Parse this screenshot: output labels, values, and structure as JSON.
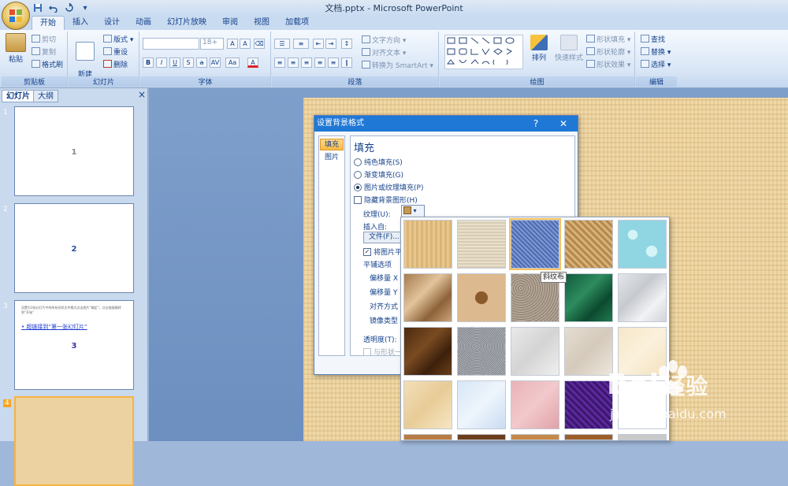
{
  "window": {
    "title": "文档.pptx - Microsoft PowerPoint"
  },
  "qat": {
    "save": "save-icon",
    "undo": "undo-icon",
    "redo": "redo-icon",
    "customize": "▾"
  },
  "tabs": [
    "开始",
    "插入",
    "设计",
    "动画",
    "幻灯片放映",
    "审阅",
    "视图",
    "加载项"
  ],
  "ribbon": {
    "clipboard": {
      "name": "剪贴板",
      "paste": "粘贴",
      "cut": "剪切",
      "copy": "复制",
      "painter": "格式刷"
    },
    "slides": {
      "name": "幻灯片",
      "new_slide": "新建\n幻灯片",
      "layout": "版式",
      "reset": "重设",
      "delete": "删除"
    },
    "font": {
      "name": "字体",
      "size": "18+",
      "grow": "A",
      "shrink": "A",
      "bold": "B",
      "italic": "I",
      "underline": "U",
      "strike": "S",
      "case": "Aa",
      "color": "A"
    },
    "paragraph": {
      "name": "段落",
      "text_dir": "文字方向",
      "align_text": "对齐文本",
      "smartart": "转换为 SmartArt"
    },
    "drawing": {
      "name": "绘图",
      "arrange": "排列",
      "quick_styles": "快速样式",
      "fill": "形状填充",
      "outline": "形状轮廓",
      "effects": "形状效果"
    },
    "editing": {
      "name": "编辑",
      "find": "查找",
      "replace": "替换",
      "select": "选择"
    }
  },
  "pane": {
    "tabs": [
      "幻灯片",
      "大纲"
    ],
    "close": "×",
    "slides": [
      {
        "num": "1",
        "label": "1"
      },
      {
        "num": "2",
        "label": "2"
      },
      {
        "num": "3",
        "label": "3",
        "body": "设置为3张幻灯片中的所有形状文件格式点击图片“确定”，点击链接跳转到“开始”",
        "link": "超链接到“第一张幻灯片”"
      },
      {
        "num": "4",
        "label": ""
      }
    ]
  },
  "dialog": {
    "title": "设置背景格式",
    "help": "?",
    "close": "✕",
    "nav": [
      "填充",
      "图片"
    ],
    "heading": "填充",
    "options": [
      "纯色填充(S)",
      "渐变填充(G)",
      "图片或纹理填充(P)"
    ],
    "hide_graphics": "隐藏背景图形(H)",
    "texture_label": "纹理(U):",
    "insert_from": "插入自:",
    "file_button": "文件(F)...",
    "tile": "将图片平",
    "tile_options": "平铺选项",
    "offset_x": "偏移量 X",
    "offset_y": "偏移量 Y",
    "alignment": "对齐方式",
    "mirror": "镜像类型",
    "transparency": "透明度(T):",
    "rotate": "与形状一"
  },
  "gallery": {
    "tooltip": "斜纹布",
    "textures": [
      "papyrus",
      "canvas",
      "denim",
      "woven-mat",
      "water-droplets",
      "paper-bag",
      "fish-fossil",
      "sand",
      "green-marble",
      "white-marble",
      "brown-marble",
      "granite",
      "newsprint",
      "recycled-paper",
      "parchment",
      "stationery",
      "blue-tissue",
      "pink-tissue",
      "purple-mesh",
      "bouquet",
      "cork",
      "walnut",
      "oak",
      "medium-wood",
      "gray"
    ]
  },
  "watermark": {
    "brand": "Bai",
    "brand2": "经验",
    "url": "jingyan.baidu.com"
  }
}
